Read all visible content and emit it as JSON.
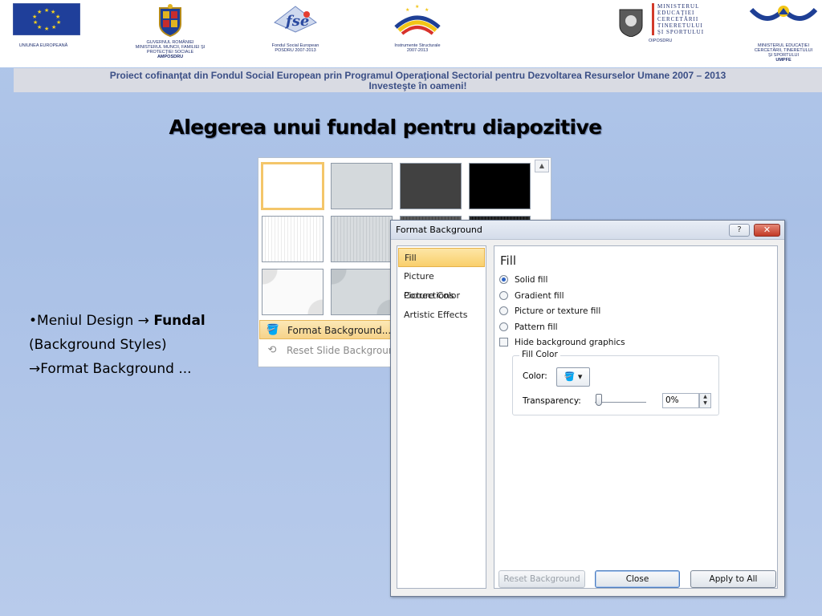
{
  "header": {
    "logos": [
      {
        "name": "eu-flag",
        "caption": "UNIUNEA EUROPEANĂ"
      },
      {
        "name": "romania-coat-of-arms",
        "caption_lines": [
          "GUVERNUL ROMÂNIEI",
          "MINISTERUL MUNCII, FAMILIEI ŞI",
          "PROTECŢIEI SOCIALE",
          "AMPOSDRU"
        ]
      },
      {
        "name": "fse-logo",
        "caption_lines": [
          "Fondul Social European",
          "POSDRU 2007-2013"
        ]
      },
      {
        "name": "instrumente-structurale-logo",
        "caption_lines": [
          "Instrumente Structurale",
          "2007-2013"
        ]
      },
      {
        "name": "ministerul-educatiei-logo",
        "text_lines": [
          "MINISTERUL",
          "EDUCAŢIEI",
          "CERCETĂRII",
          "TINERETULUI",
          "ŞI SPORTULUI"
        ],
        "caption": "OIPOSDRU"
      },
      {
        "name": "umpfe-logo",
        "caption_lines": [
          "MINISTERUL EDUCAŢIEI",
          "CERCETĂRII, TINERETULUI",
          "ŞI SPORTULUI",
          "UMPFE"
        ]
      }
    ],
    "banner_line1": "Proiect cofinanţat din Fondul Social European prin Programul Operaţional Sectorial pentru Dezvoltarea Resurselor Umane 2007 – 2013",
    "banner_line2": "Investeşte în oameni!"
  },
  "slide": {
    "title": "Alegerea unui fundal pentru diapozitive",
    "bullet": {
      "prefix": "•Meniul Design",
      "arrow": "→",
      "bold": "Fundal",
      "line2": "(Background Styles)",
      "line3": "→Format Background ..."
    }
  },
  "gallery": {
    "menu": [
      {
        "label": "Format Background...",
        "underline": "B",
        "highlighted": true
      },
      {
        "label": "Reset Slide Background",
        "underline": "R",
        "disabled": true
      }
    ]
  },
  "dialog": {
    "title": "Format Background",
    "help": "?",
    "close": "✕",
    "nav": [
      "Fill",
      "Picture Corrections",
      "Picture Color",
      "Artistic Effects"
    ],
    "selected_nav": "Fill",
    "panel": {
      "heading": "Fill",
      "options": [
        {
          "label": "Solid fill",
          "checked": true
        },
        {
          "label": "Gradient fill",
          "checked": false
        },
        {
          "label": "Picture or texture fill",
          "checked": false
        },
        {
          "label": "Pattern fill",
          "checked": false
        }
      ],
      "hide_graphics": "Hide background graphics",
      "fill_color_group": "Fill Color",
      "color_label": "Color:",
      "transparency_label": "Transparency:",
      "transparency_value": "0%",
      "transparency_level": 0
    },
    "buttons": {
      "reset": "Reset Background",
      "close": "Close",
      "apply": "Apply to All"
    }
  }
}
